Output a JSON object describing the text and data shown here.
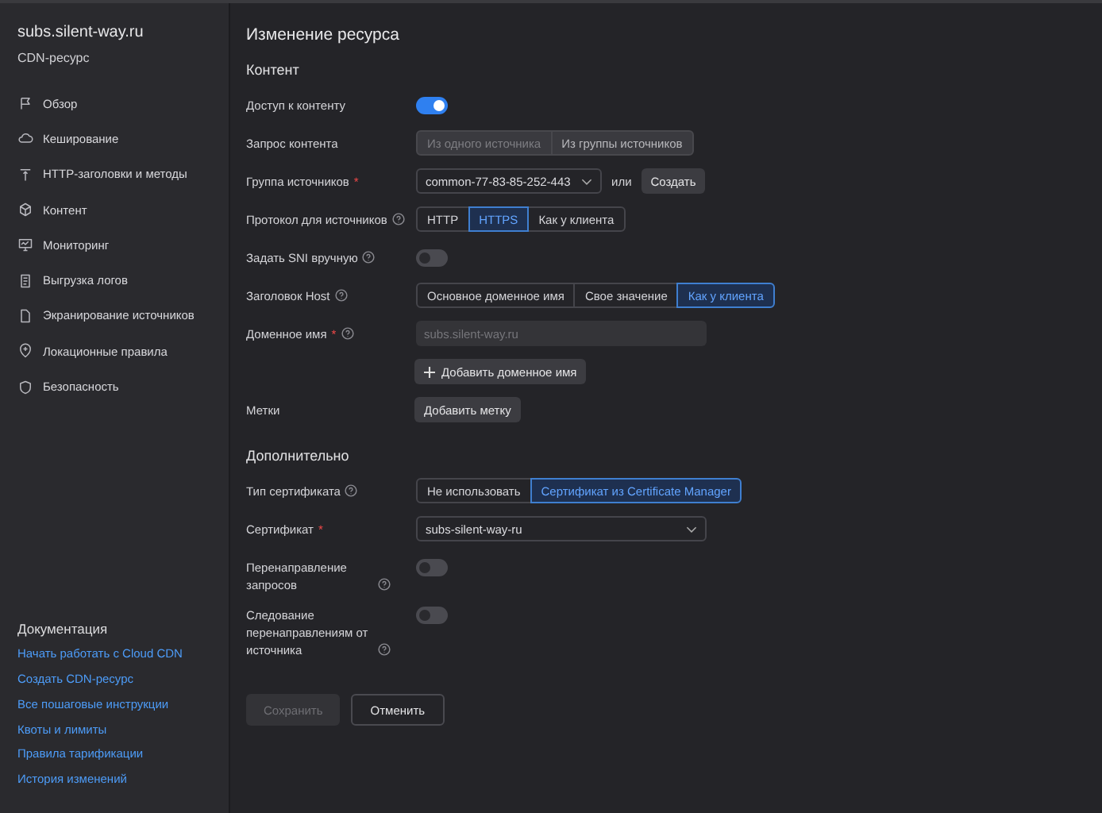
{
  "sidebar": {
    "title": "subs.silent-way.ru",
    "subtitle": "CDN-ресурс",
    "items": [
      {
        "label": "Обзор"
      },
      {
        "label": "Кеширование"
      },
      {
        "label": "HTTP-заголовки и методы"
      },
      {
        "label": "Контент"
      },
      {
        "label": "Мониторинг"
      },
      {
        "label": "Выгрузка логов"
      },
      {
        "label": "Экранирование источников"
      },
      {
        "label": "Локационные правила"
      },
      {
        "label": "Безопасность"
      }
    ],
    "docs": {
      "title": "Документация",
      "links": [
        "Начать работать с Cloud CDN",
        "Создать CDN-ресурс",
        "Все пошаговые инструкции",
        "Квоты и лимиты",
        "Правила тарификации",
        "История изменений"
      ]
    }
  },
  "page_title": "Изменение ресурса",
  "sections": [
    {
      "title": "Контент",
      "rows": [
        {
          "label": "Доступ к контенту",
          "kind": "toggle",
          "on": true
        },
        {
          "label": "Запрос контента",
          "kind": "segmented",
          "disabled": true,
          "options": [
            {
              "label": "Из одного источника",
              "selected": false
            },
            {
              "label": "Из группы источников",
              "selected": true
            }
          ]
        },
        {
          "label": "Группа источников",
          "required_mark": "*",
          "kind": "select",
          "value": "common-77-83-85-252-443",
          "or_text": "или",
          "button": "Создать"
        },
        {
          "label": "Протокол для источников",
          "help": true,
          "kind": "segmented",
          "options": [
            {
              "label": "HTTP",
              "selected": false
            },
            {
              "label": "HTTPS",
              "selected": true
            },
            {
              "label": "Как у клиента",
              "selected": false
            }
          ]
        },
        {
          "label": "Задать SNI вручную",
          "help": true,
          "kind": "toggle",
          "on": false
        },
        {
          "label": "Заголовок Host",
          "help": true,
          "kind": "segmented",
          "options": [
            {
              "label": "Основное доменное имя",
              "selected": false
            },
            {
              "label": "Свое значение",
              "selected": false
            },
            {
              "label": "Как у клиента",
              "selected": true
            }
          ]
        },
        {
          "label": "Доменное имя",
          "required_mark": "*",
          "help": true,
          "kind": "input",
          "placeholder": "subs.silent-way.ru"
        },
        {
          "kind": "add",
          "button": "Добавить доменное имя"
        },
        {
          "label": "Метки",
          "kind": "button",
          "button": "Добавить метку"
        }
      ]
    },
    {
      "title": "Дополнительно",
      "rows": [
        {
          "label": "Тип сертификата",
          "help": true,
          "kind": "segmented",
          "options": [
            {
              "label": "Не использовать",
              "selected": false
            },
            {
              "label": "Сертификат из Certificate Manager",
              "selected": true
            }
          ]
        },
        {
          "label": "Сертификат",
          "required_mark": "*",
          "kind": "select",
          "value": "subs-silent-way-ru"
        },
        {
          "label": "Перенаправление запросов",
          "help": true,
          "kind": "toggle",
          "on": false
        },
        {
          "label": "Следование перенаправлениям от источника",
          "help": true,
          "kind": "toggle",
          "on": false
        }
      ]
    }
  ],
  "footer": [
    {
      "label": "Сохранить",
      "disabled": true
    },
    {
      "label": "Отменить",
      "disabled": false
    }
  ]
}
